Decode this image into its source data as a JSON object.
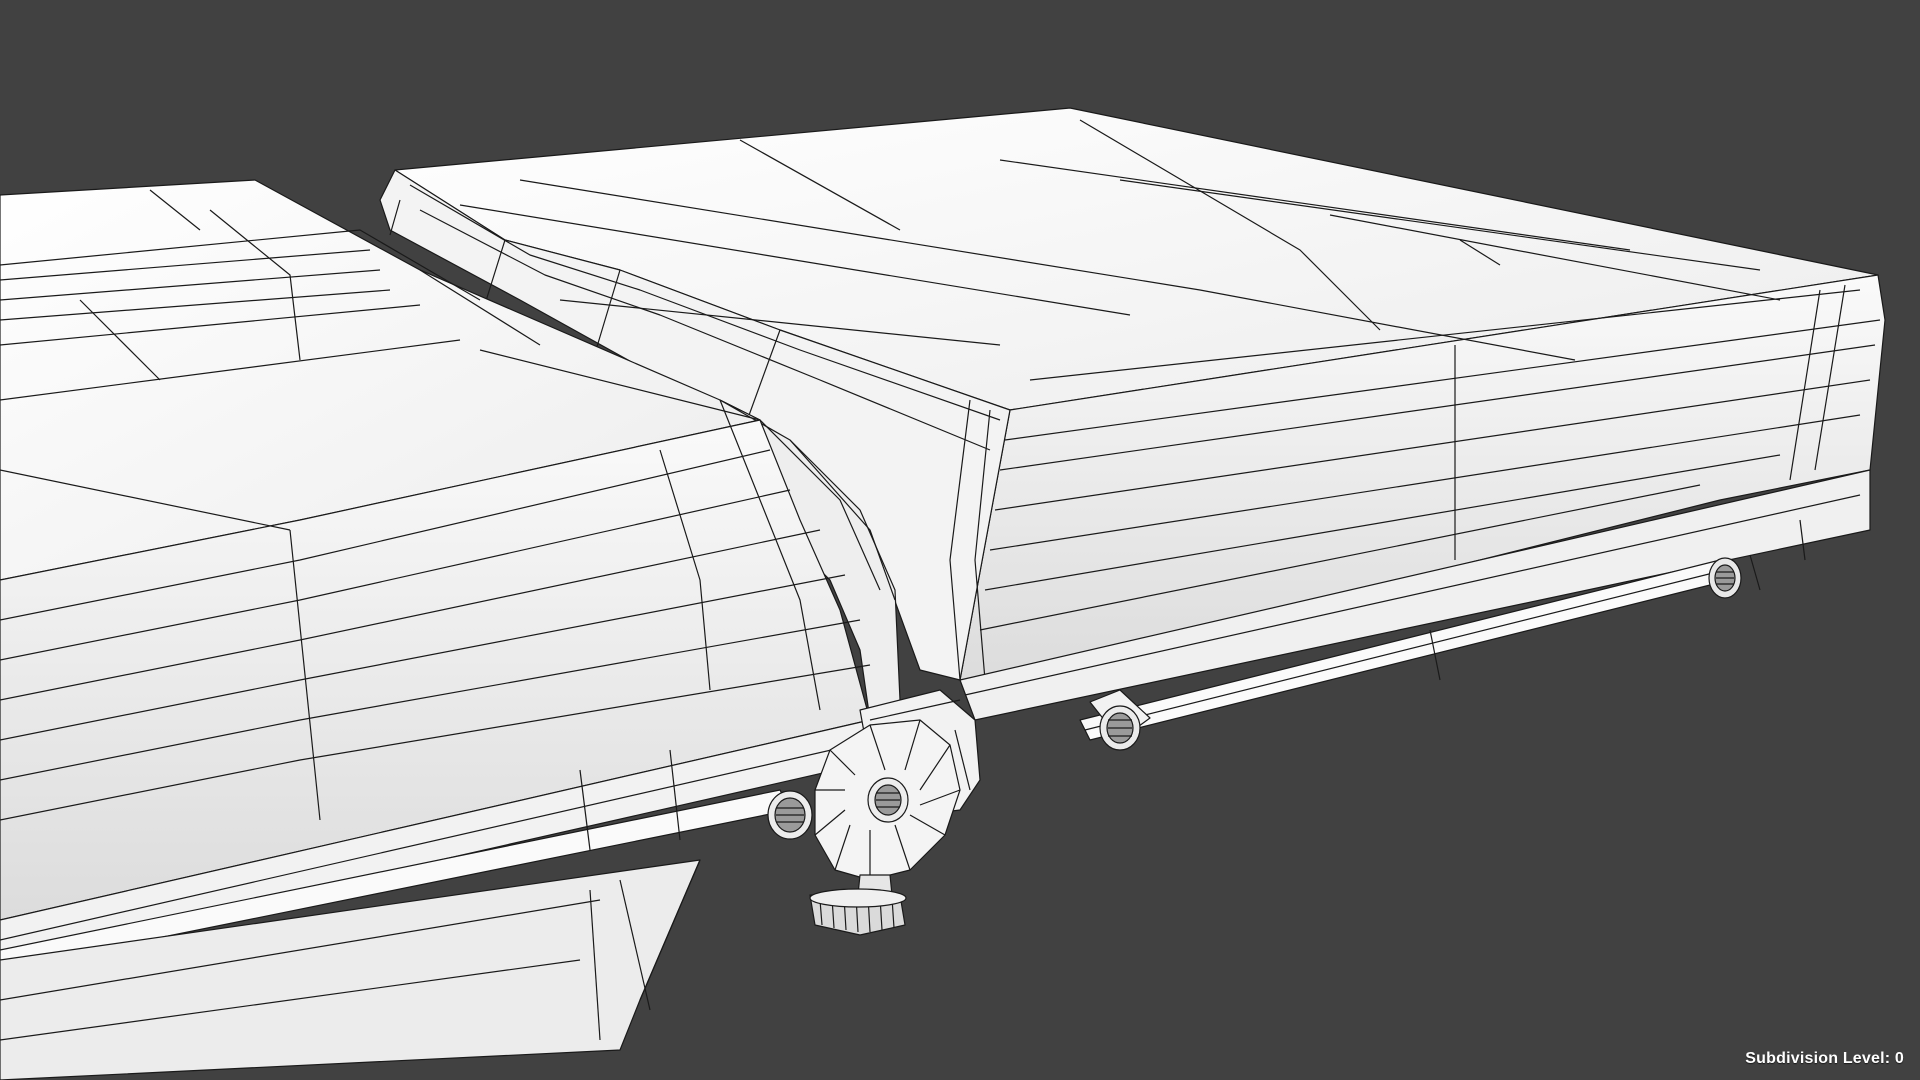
{
  "viewport": {
    "background": "#414141",
    "mesh_fill": "#f6f6f6",
    "mesh_shade": "#e2e2e2",
    "wire_color": "#1a1a1a"
  },
  "hud": {
    "label": "Subdivision Level:",
    "value": "0",
    "text": "Subdivision Level: 0"
  }
}
